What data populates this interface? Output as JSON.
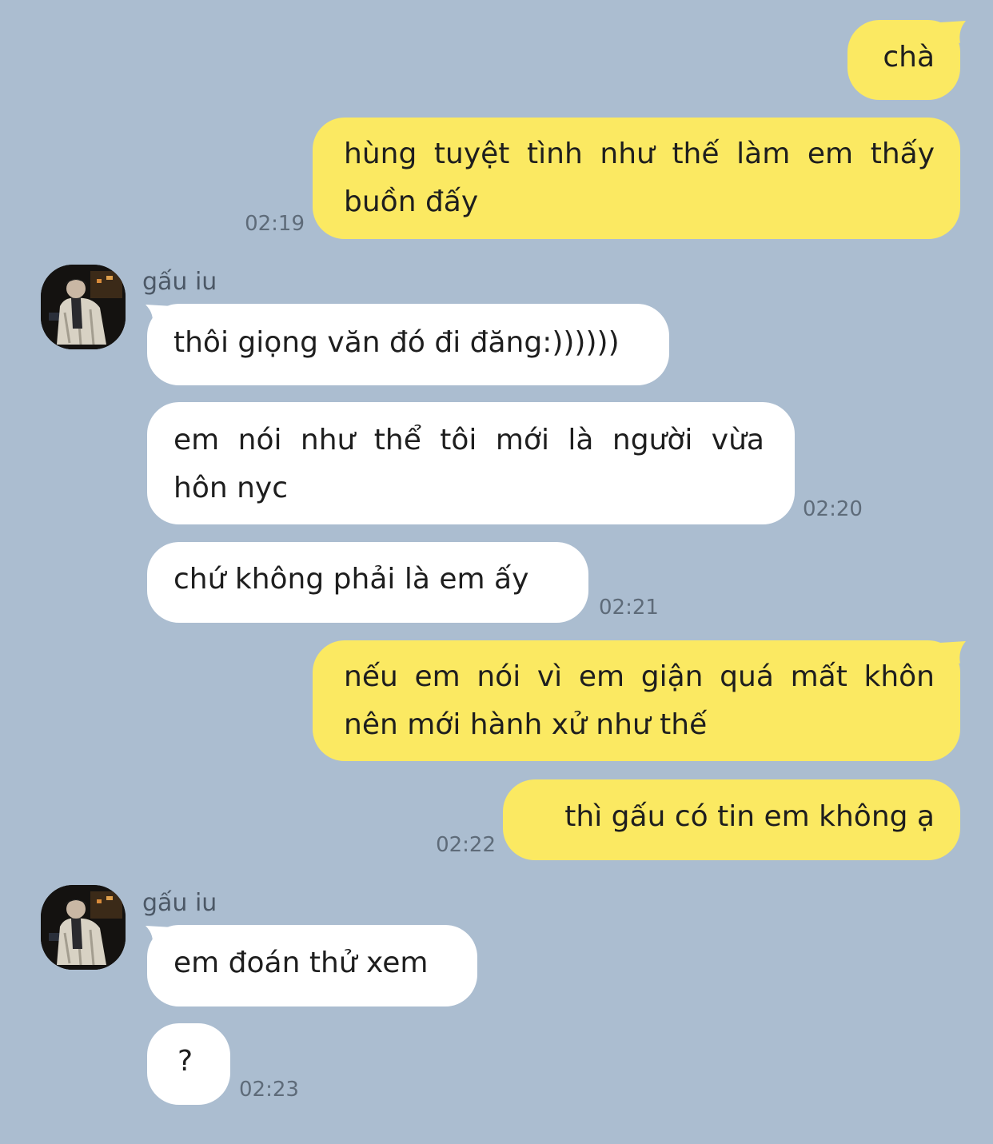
{
  "contact": {
    "name": "gấu iu"
  },
  "colors": {
    "background": "#abbdd0",
    "outgoing_bubble": "#fbe962",
    "incoming_bubble": "#ffffff",
    "timestamp": "#5e6b79"
  },
  "messages": [
    {
      "direction": "outgoing",
      "lines": [
        "chà"
      ]
    },
    {
      "direction": "outgoing",
      "lines": [
        "hùng tuyệt tình như thế làm em thấy",
        "buồn đấy"
      ],
      "time": "02:19"
    },
    {
      "direction": "incoming",
      "sender": "gấu iu",
      "lines": [
        "thôi giọng văn đó đi đăng:))))))"
      ]
    },
    {
      "direction": "incoming",
      "lines": [
        "em nói như thể tôi mới là người vừa",
        "hôn nyc"
      ],
      "time": "02:20"
    },
    {
      "direction": "incoming",
      "lines": [
        "chứ không phải là em ấy"
      ],
      "time": "02:21"
    },
    {
      "direction": "outgoing",
      "lines": [
        "nếu em nói vì em giận quá mất khôn",
        "nên mới hành xử như thế"
      ]
    },
    {
      "direction": "outgoing",
      "lines": [
        "thì gấu có tin em không ạ"
      ],
      "time": "02:22"
    },
    {
      "direction": "incoming",
      "sender": "gấu iu",
      "lines": [
        "em đoán thử xem"
      ]
    },
    {
      "direction": "incoming",
      "lines": [
        "?"
      ],
      "time": "02:23"
    }
  ]
}
